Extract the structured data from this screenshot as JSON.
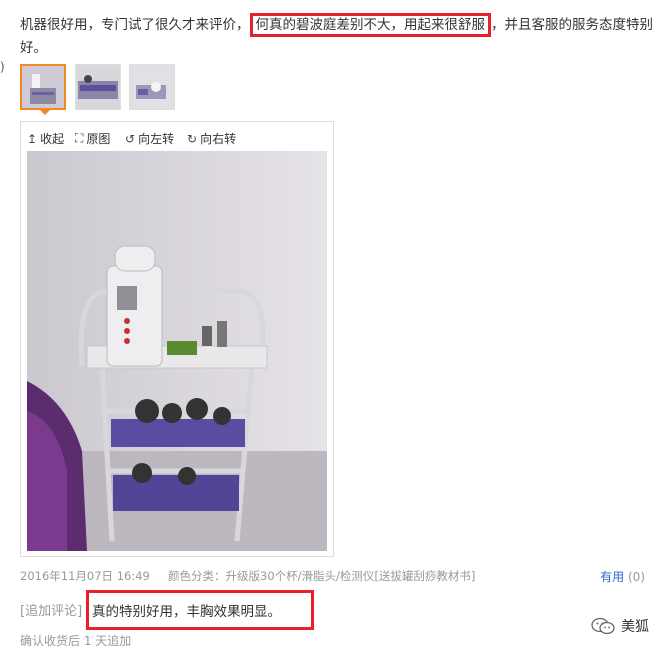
{
  "review": {
    "part1": "机器很好用，专门试了很久才来评价，",
    "highlight": "何真的碧波庭差别不大，用起来很舒服",
    "part2": "，并且客服的服务态度特别好。"
  },
  "left_edge_char": ")",
  "viewer": {
    "collapse_label": "收起",
    "original_label": "原图",
    "rotate_left_label": "向左转",
    "rotate_right_label": "向右转"
  },
  "meta": {
    "date": "2016年11月07日 16:49",
    "color_label": "颜色分类：",
    "color_value": "升级版30个杯/滑脂头/检测仪[送拔罐刮痧教材书]",
    "useful_label": "有用",
    "useful_count": "(0)"
  },
  "followup": {
    "label": "[追加评论]",
    "text": "真的特别好用，丰胸效果明显。",
    "confirm": "确认收货后 1 天追加"
  },
  "brand": {
    "name": "美狐"
  },
  "colors": {
    "highlight_border": "#e8202a",
    "active_thumb": "#f08a24",
    "link": "#3366cc"
  },
  "icons": [
    "arrow-up-icon",
    "expand-icon",
    "rotate-left-icon",
    "rotate-right-icon",
    "wechat-icon"
  ]
}
